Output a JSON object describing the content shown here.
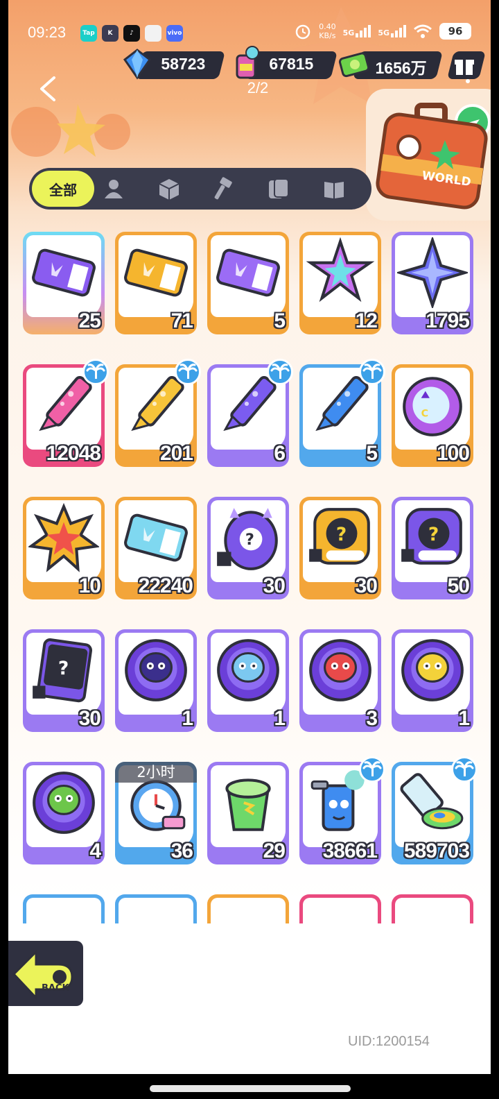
{
  "status_bar": {
    "time": "09:23",
    "app_icons": [
      {
        "name": "taptap-app-icon",
        "label": "Tap",
        "color": "#1bcfc9"
      },
      {
        "name": "kuaishou-app-icon",
        "label": "K",
        "color": "#3b3b52"
      },
      {
        "name": "tiktok-app-icon",
        "label": "♪",
        "color": "#111111"
      },
      {
        "name": "calendar-app-icon",
        "label": "",
        "color": "#f2f2f2"
      },
      {
        "name": "vivo-app-icon",
        "label": "vivo",
        "color": "#4a6cf7"
      }
    ],
    "net_speed_value": "0.40",
    "net_speed_unit": "KB/s",
    "signal_1": "5G",
    "signal_2": "5G",
    "battery": "96"
  },
  "currencies": {
    "diamonds": "58723",
    "paint": "67815",
    "cash": "1656万"
  },
  "pager": "2/2",
  "tabs": {
    "active_label": "全部",
    "icons": [
      "person-icon",
      "box-icon",
      "hammer-icon",
      "card-icon",
      "book-icon"
    ]
  },
  "items": [
    {
      "count": "25",
      "frame": "c-rainbow",
      "art": "crown-ticket",
      "badge": false
    },
    {
      "count": "71",
      "frame": "c-orange",
      "art": "gold-ticket",
      "badge": false
    },
    {
      "count": "5",
      "frame": "c-orange",
      "art": "star-ticket",
      "badge": false
    },
    {
      "count": "12",
      "frame": "c-orange",
      "art": "rainbow-star",
      "badge": false
    },
    {
      "count": "1795",
      "frame": "c-purple",
      "art": "purple-star",
      "badge": false
    },
    {
      "count": "12048",
      "frame": "c-pink",
      "art": "pink-crayon",
      "badge": true
    },
    {
      "count": "201",
      "frame": "c-orange",
      "art": "yellow-crayon",
      "badge": true
    },
    {
      "count": "6",
      "frame": "c-purple",
      "art": "purple-crayon",
      "badge": true
    },
    {
      "count": "5",
      "frame": "c-blue",
      "art": "blue-crayon",
      "badge": true
    },
    {
      "count": "100",
      "frame": "c-orange",
      "art": "cool-badge",
      "badge": false
    },
    {
      "count": "10",
      "frame": "c-orange",
      "art": "burst-badge",
      "badge": false
    },
    {
      "count": "22240",
      "frame": "c-orange",
      "art": "season-ticket",
      "badge": false
    },
    {
      "count": "30",
      "frame": "c-purple",
      "art": "mystery-egg",
      "badge": false
    },
    {
      "count": "30",
      "frame": "c-orange",
      "art": "deity-gold",
      "badge": false
    },
    {
      "count": "50",
      "frame": "c-purple",
      "art": "deity-purple",
      "badge": false
    },
    {
      "count": "30",
      "frame": "c-purple",
      "art": "travel-card",
      "badge": false
    },
    {
      "count": "1",
      "frame": "c-purple",
      "art": "bat-pet",
      "badge": false
    },
    {
      "count": "1",
      "frame": "c-purple",
      "art": "fish-pet",
      "badge": false
    },
    {
      "count": "3",
      "frame": "c-purple",
      "art": "shark-pet",
      "badge": false
    },
    {
      "count": "1",
      "frame": "c-purple",
      "art": "squid-pet",
      "badge": false
    },
    {
      "count": "4",
      "frame": "c-purple",
      "art": "sprout-pet",
      "badge": false
    },
    {
      "count": "36",
      "frame": "c-blue",
      "art": "alarm-clock",
      "badge": false,
      "timer": "2小时"
    },
    {
      "count": "29",
      "frame": "c-purple",
      "art": "jelly-cup",
      "badge": false
    },
    {
      "count": "38661",
      "frame": "c-purple",
      "art": "paint-can",
      "badge": true
    },
    {
      "count": "589703",
      "frame": "c-blue",
      "art": "paint-tube",
      "badge": true
    }
  ],
  "partial_row_frames": [
    "c-blue",
    "c-blue",
    "c-orange",
    "c-pink",
    "c-pink"
  ],
  "back_label": "BACK",
  "suitcase_label": "WORLD",
  "uid": "UID:1200154",
  "colors": {
    "accent_yellow": "#ebf35a",
    "dark": "#2e2f3b",
    "purple_frame": "#9b7af2",
    "orange_frame": "#f3a53a",
    "pink_frame": "#ea4a7f",
    "blue_frame": "#52a8ec"
  }
}
